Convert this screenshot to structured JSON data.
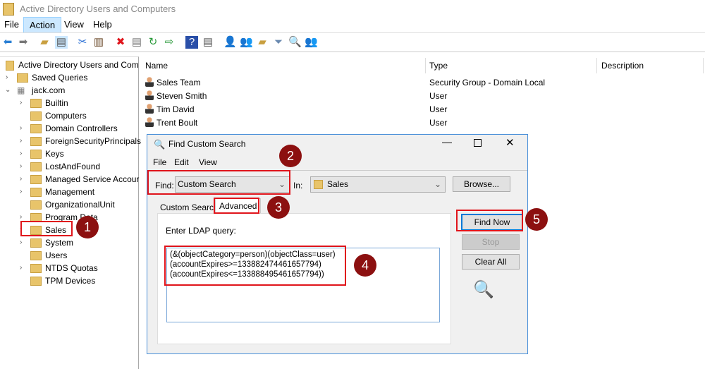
{
  "window": {
    "title": "Active Directory Users and Computers"
  },
  "menu": [
    "File",
    "Action",
    "View",
    "Help"
  ],
  "tree": {
    "root": "Active Directory Users and Com",
    "saved_queries": "Saved Queries",
    "domain": "jack.com",
    "children": [
      {
        "label": "Builtin",
        "exp": true
      },
      {
        "label": "Computers",
        "exp": false
      },
      {
        "label": "Domain Controllers",
        "exp": true
      },
      {
        "label": "ForeignSecurityPrincipals",
        "exp": true
      },
      {
        "label": "Keys",
        "exp": true
      },
      {
        "label": "LostAndFound",
        "exp": true
      },
      {
        "label": "Managed Service Accour",
        "exp": true
      },
      {
        "label": "Management",
        "exp": true
      },
      {
        "label": "OrganizationalUnit",
        "exp": false
      },
      {
        "label": "Program Data",
        "exp": true
      },
      {
        "label": "Sales",
        "exp": true
      },
      {
        "label": "System",
        "exp": true
      },
      {
        "label": "Users",
        "exp": false
      },
      {
        "label": "NTDS Quotas",
        "exp": true
      },
      {
        "label": "TPM Devices",
        "exp": false
      }
    ]
  },
  "list": {
    "columns": [
      "Name",
      "Type",
      "Description"
    ],
    "rows": [
      {
        "name": "Sales Team",
        "type": "Security Group - Domain Local"
      },
      {
        "name": "Steven Smith",
        "type": "User"
      },
      {
        "name": "Tim David",
        "type": "User"
      },
      {
        "name": "Trent Boult",
        "type": "User"
      }
    ]
  },
  "dialog": {
    "title": "Find Custom Search",
    "menu": [
      "File",
      "Edit",
      "View"
    ],
    "find_label": "Find:",
    "find_value": "Custom Search",
    "in_label": "In:",
    "in_value": "Sales",
    "browse": "Browse...",
    "tabs": [
      "Custom Search",
      "Advanced"
    ],
    "ldap_label": "Enter LDAP query:",
    "query_lines": [
      "(&(objectCategory=person)(objectClass=user)",
      "(accountExpires>=133882474461657794)",
      "(accountExpires<=133888495461657794))"
    ],
    "find_now": "Find Now",
    "stop": "Stop",
    "clear_all": "Clear All"
  },
  "annotations": [
    "1",
    "2",
    "3",
    "4",
    "5"
  ],
  "colors": {
    "highlight": "#e0141b",
    "badge": "#8c1010"
  }
}
